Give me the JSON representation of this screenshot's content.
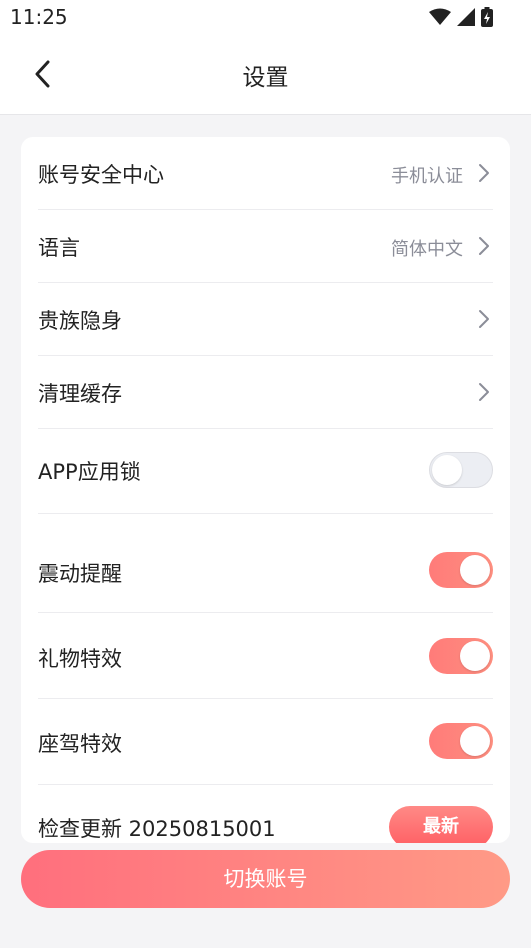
{
  "status_bar": {
    "time": "11:25"
  },
  "header": {
    "title": "设置"
  },
  "settings": {
    "account_security": {
      "label": "账号安全中心",
      "value": "手机认证"
    },
    "language": {
      "label": "语言",
      "value": "简体中文"
    },
    "noble_stealth": {
      "label": "贵族隐身"
    },
    "clear_cache": {
      "label": "清理缓存"
    },
    "app_lock": {
      "label": "APP应用锁",
      "enabled": false
    },
    "vibration": {
      "label": "震动提醒",
      "enabled": true
    },
    "gift_effects": {
      "label": "礼物特效",
      "enabled": true
    },
    "mount_effects": {
      "label": "座驾特效",
      "enabled": true
    },
    "check_update": {
      "label": "检查更新 20250815001",
      "badge": "最新"
    }
  },
  "footer": {
    "switch_account_label": "切换账号"
  },
  "colors": {
    "accent": "#ff7b79",
    "toggle_off": "#eceef3",
    "background": "#f4f4f6"
  }
}
